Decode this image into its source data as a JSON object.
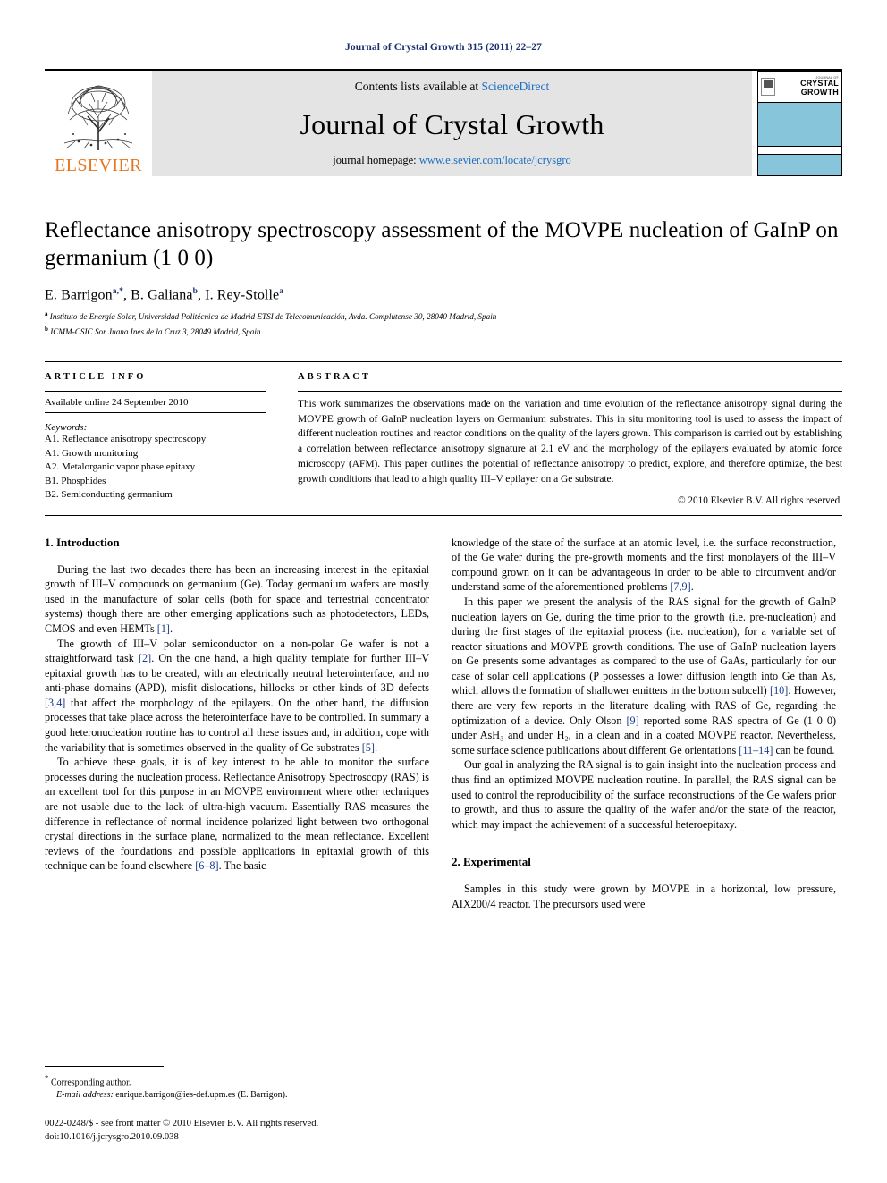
{
  "running_head": "Journal of Crystal Growth 315 (2011) 22–27",
  "masthead": {
    "publisher": "ELSEVIER",
    "contents_prefix": "Contents lists available at ",
    "contents_link": "ScienceDirect",
    "journal_title": "Journal of Crystal Growth",
    "homepage_prefix": "journal homepage: ",
    "homepage_url": "www.elsevier.com/locate/jcrysgro",
    "cover_kicker": "JOURNAL OF",
    "cover_title_line1": "CRYSTAL",
    "cover_title_line2": "GROWTH"
  },
  "article": {
    "title": "Reflectance anisotropy spectroscopy assessment of the MOVPE nucleation of GaInP on germanium (1 0 0)",
    "authors": [
      {
        "name": "E. Barrigon",
        "marks": "a,*"
      },
      {
        "name": "B. Galiana",
        "marks": "b"
      },
      {
        "name": "I. Rey-Stolle",
        "marks": "a"
      }
    ],
    "affiliations": [
      {
        "mark": "a",
        "text": "Instituto de Energía Solar, Universidad Politécnica de Madrid ETSI de Telecomunicación, Avda. Complutense 30, 28040 Madrid, Spain"
      },
      {
        "mark": "b",
        "text": "ICMM-CSIC Sor Juana Ines de la Cruz 3, 28049 Madrid, Spain"
      }
    ]
  },
  "info": {
    "heading": "ARTICLE INFO",
    "history": "Available online 24 September 2010",
    "keywords_label": "Keywords:",
    "keywords": [
      "A1. Reflectance anisotropy spectroscopy",
      "A1. Growth monitoring",
      "A2. Metalorganic vapor phase epitaxy",
      "B1. Phosphides",
      "B2. Semiconducting germanium"
    ]
  },
  "abstract": {
    "heading": "ABSTRACT",
    "text": "This work summarizes the observations made on the variation and time evolution of the reflectance anisotropy signal during the MOVPE growth of GaInP nucleation layers on Germanium substrates. This in situ monitoring tool is used to assess the impact of different nucleation routines and reactor conditions on the quality of the layers grown. This comparison is carried out by establishing a correlation between reflectance anisotropy signature at 2.1 eV and the morphology of the epilayers evaluated by atomic force microscopy (AFM). This paper outlines the potential of reflectance anisotropy to predict, explore, and therefore optimize, the best growth conditions that lead to a high quality III–V epilayer on a Ge substrate.",
    "copyright": "© 2010 Elsevier B.V. All rights reserved."
  },
  "sections": {
    "intro_heading": "1. Introduction",
    "intro_p1": "During the last two decades there has been an increasing interest in the epitaxial growth of III–V compounds on germanium (Ge). Today germanium wafers are mostly used in the manufacture of solar cells (both for space and terrestrial concentrator systems) though there are other emerging applications such as photodetectors, LEDs, CMOS and even HEMTs [1].",
    "intro_p2": "The growth of III–V polar semiconductor on a non-polar Ge wafer is not a straightforward task [2]. On the one hand, a high quality template for further III–V epitaxial growth has to be created, with an electrically neutral heterointerface, and no anti-phase domains (APD), misfit dislocations, hillocks or other kinds of 3D defects [3,4] that affect the morphology of the epilayers. On the other hand, the diffusion processes that take place across the heterointerface have to be controlled. In summary a good heteronucleation routine has to control all these issues and, in addition, cope with the variability that is sometimes observed in the quality of Ge substrates [5].",
    "intro_p3": "To achieve these goals, it is of key interest to be able to monitor the surface processes during the nucleation process. Reflectance Anisotropy Spectroscopy (RAS) is an excellent tool for this purpose in an MOVPE environment where other techniques are not usable due to the lack of ultra-high vacuum. Essentially RAS measures the difference in reflectance of normal incidence polarized light between two orthogonal crystal directions in the surface plane, normalized to the mean reflectance. Excellent reviews of the foundations and possible applications in epitaxial growth of this technique can be found elsewhere [6–8]. The basic",
    "intro_p4": "knowledge of the state of the surface at an atomic level, i.e. the surface reconstruction, of the Ge wafer during the pre-growth moments and the first monolayers of the III–V compound grown on it can be advantageous in order to be able to circumvent and/or understand some of the aforementioned problems [7,9].",
    "intro_p5": "In this paper we present the analysis of the RAS signal for the growth of GaInP nucleation layers on Ge, during the time prior to the growth (i.e. pre-nucleation) and during the first stages of the epitaxial process (i.e. nucleation), for a variable set of reactor situations and MOVPE growth conditions. The use of GaInP nucleation layers on Ge presents some advantages as compared to the use of GaAs, particularly for our case of solar cell applications (P possesses a lower diffusion length into Ge than As, which allows the formation of shallower emitters in the bottom subcell) [10]. However, there are very few reports in the literature dealing with RAS of Ge, regarding the optimization of a device. Only Olson [9] reported some RAS spectra of Ge (1 0 0) under AsH₃ and under H₂, in a clean and in a coated MOVPE reactor. Nevertheless, some surface science publications about different Ge orientations [11–14] can be found.",
    "intro_p6": "Our goal in analyzing the RA signal is to gain insight into the nucleation process and thus find an optimized MOVPE nucleation routine. In parallel, the RAS signal can be used to control the reproducibility of the surface reconstructions of the Ge wafers prior to growth, and thus to assure the quality of the wafer and/or the state of the reactor, which may impact the achievement of a successful heteroepitaxy.",
    "exp_heading": "2. Experimental",
    "exp_p1": "Samples in this study were grown by MOVPE in a horizontal, low pressure, AIX200/4 reactor. The precursors used were"
  },
  "footnotes": {
    "corresponding": "Corresponding author.",
    "email_label": "E-mail address:",
    "email_value": "enrique.barrigon@ies-def.upm.es (E. Barrigon).",
    "issn_line": "0022-0248/$ - see front matter © 2010 Elsevier B.V. All rights reserved.",
    "doi_line": "doi:10.1016/j.jcrysgro.2010.09.038"
  },
  "colors": {
    "link": "#1b6ec2",
    "reference": "#1b3a8c",
    "elsevier_orange": "#e8741b",
    "cover_band": "#86c5da",
    "running_head": "#1a2f6e"
  }
}
